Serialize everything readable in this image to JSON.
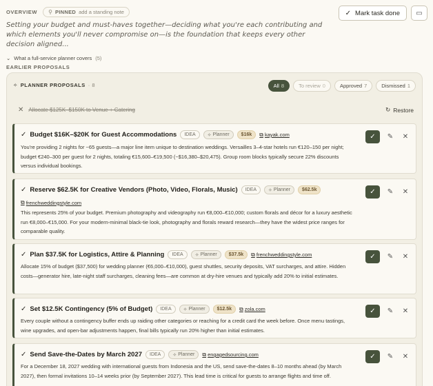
{
  "overview": {
    "label": "OVERVIEW",
    "pinned_label": "PINNED",
    "pinned_note": "add a standing note",
    "text": "Setting your budget and must-haves together—deciding what you're each contributing and which elements you'll never compromise on—is the foundation that keeps every other decision aligned...",
    "covers_label": "What a full-service planner covers",
    "covers_count": "(5)"
  },
  "actions": {
    "mark_done": "Mark task done"
  },
  "earlier_label": "EARLIER PROPOSALS",
  "panel": {
    "title": "PLANNER PROPOSALS",
    "count": "· 8",
    "filters": [
      {
        "label": "All",
        "count": "8"
      },
      {
        "label": "To review",
        "count": "0"
      },
      {
        "label": "Approved",
        "count": "7"
      },
      {
        "label": "Dismissed",
        "count": "1"
      }
    ],
    "dismissed_item": "Allocate $125K–$150K to Venue + Catering",
    "restore_label": "Restore"
  },
  "cards": [
    {
      "title": "Budget $16K–$20K for Guest Accommodations",
      "tag": "IDEA",
      "planner": "Planner",
      "amount": "$16k",
      "link": "kayak.com",
      "body": "You're providing 2 nights for ~65 guests—a major line item unique to destination weddings. Versailles 3–4-star hotels run €120–150 per night; budget €240–300 per guest for 2 nights, totaling €15,600–€19,500 (~$16,380–$20,475). Group room blocks typically secure 22% discounts versus individual bookings."
    },
    {
      "title": "Reserve $62.5K for Creative Vendors (Photo, Video, Florals, Music)",
      "tag": "IDEA",
      "planner": "Planner",
      "amount": "$62.5k",
      "link": "frenchweddingstyle.com",
      "body": "This represents 25% of your budget. Premium photography and videography run €8,000–€10,000; custom florals and décor for a luxury aesthetic run €8,000–€15,000. For your modern-minimal black-tie look, photography and florals reward research—they have the widest price ranges for comparable quality."
    },
    {
      "title": "Plan $37.5K for Logistics, Attire & Planning",
      "tag": "IDEA",
      "planner": "Planner",
      "amount": "$37.5k",
      "link": "frenchweddingstyle.com",
      "body": "Allocate 15% of budget ($37,500) for wedding planner (€6,000–€10,000), guest shuttles, security deposits, VAT surcharges, and attire. Hidden costs—generator hire, late-night staff surcharges, cleaning fees—are common at dry-hire venues and typically add 20% to initial estimates."
    },
    {
      "title": "Set $12.5K Contingency (5% of Budget)",
      "tag": "IDEA",
      "planner": "Planner",
      "amount": "$12.5k",
      "link": "zola.com",
      "body": "Every couple without a contingency buffer ends up raiding other categories or reaching for a credit card the week before. Once menu tastings, wine upgrades, and open-bar adjustments happen, final bills typically run 20% higher than initial estimates."
    },
    {
      "title": "Send Save-the-Dates by March 2027",
      "tag": "IDEA",
      "planner": "Planner",
      "link": "engagedsourcing.com",
      "body": "For a December 18, 2027 wedding with international guests from Indonesia and the US, send save-the-dates 8–10 months ahead (by March 2027), then formal invitations 10–14 weeks prior (by September 2027). This lead time is critical for guests to arrange flights and time off."
    }
  ]
}
